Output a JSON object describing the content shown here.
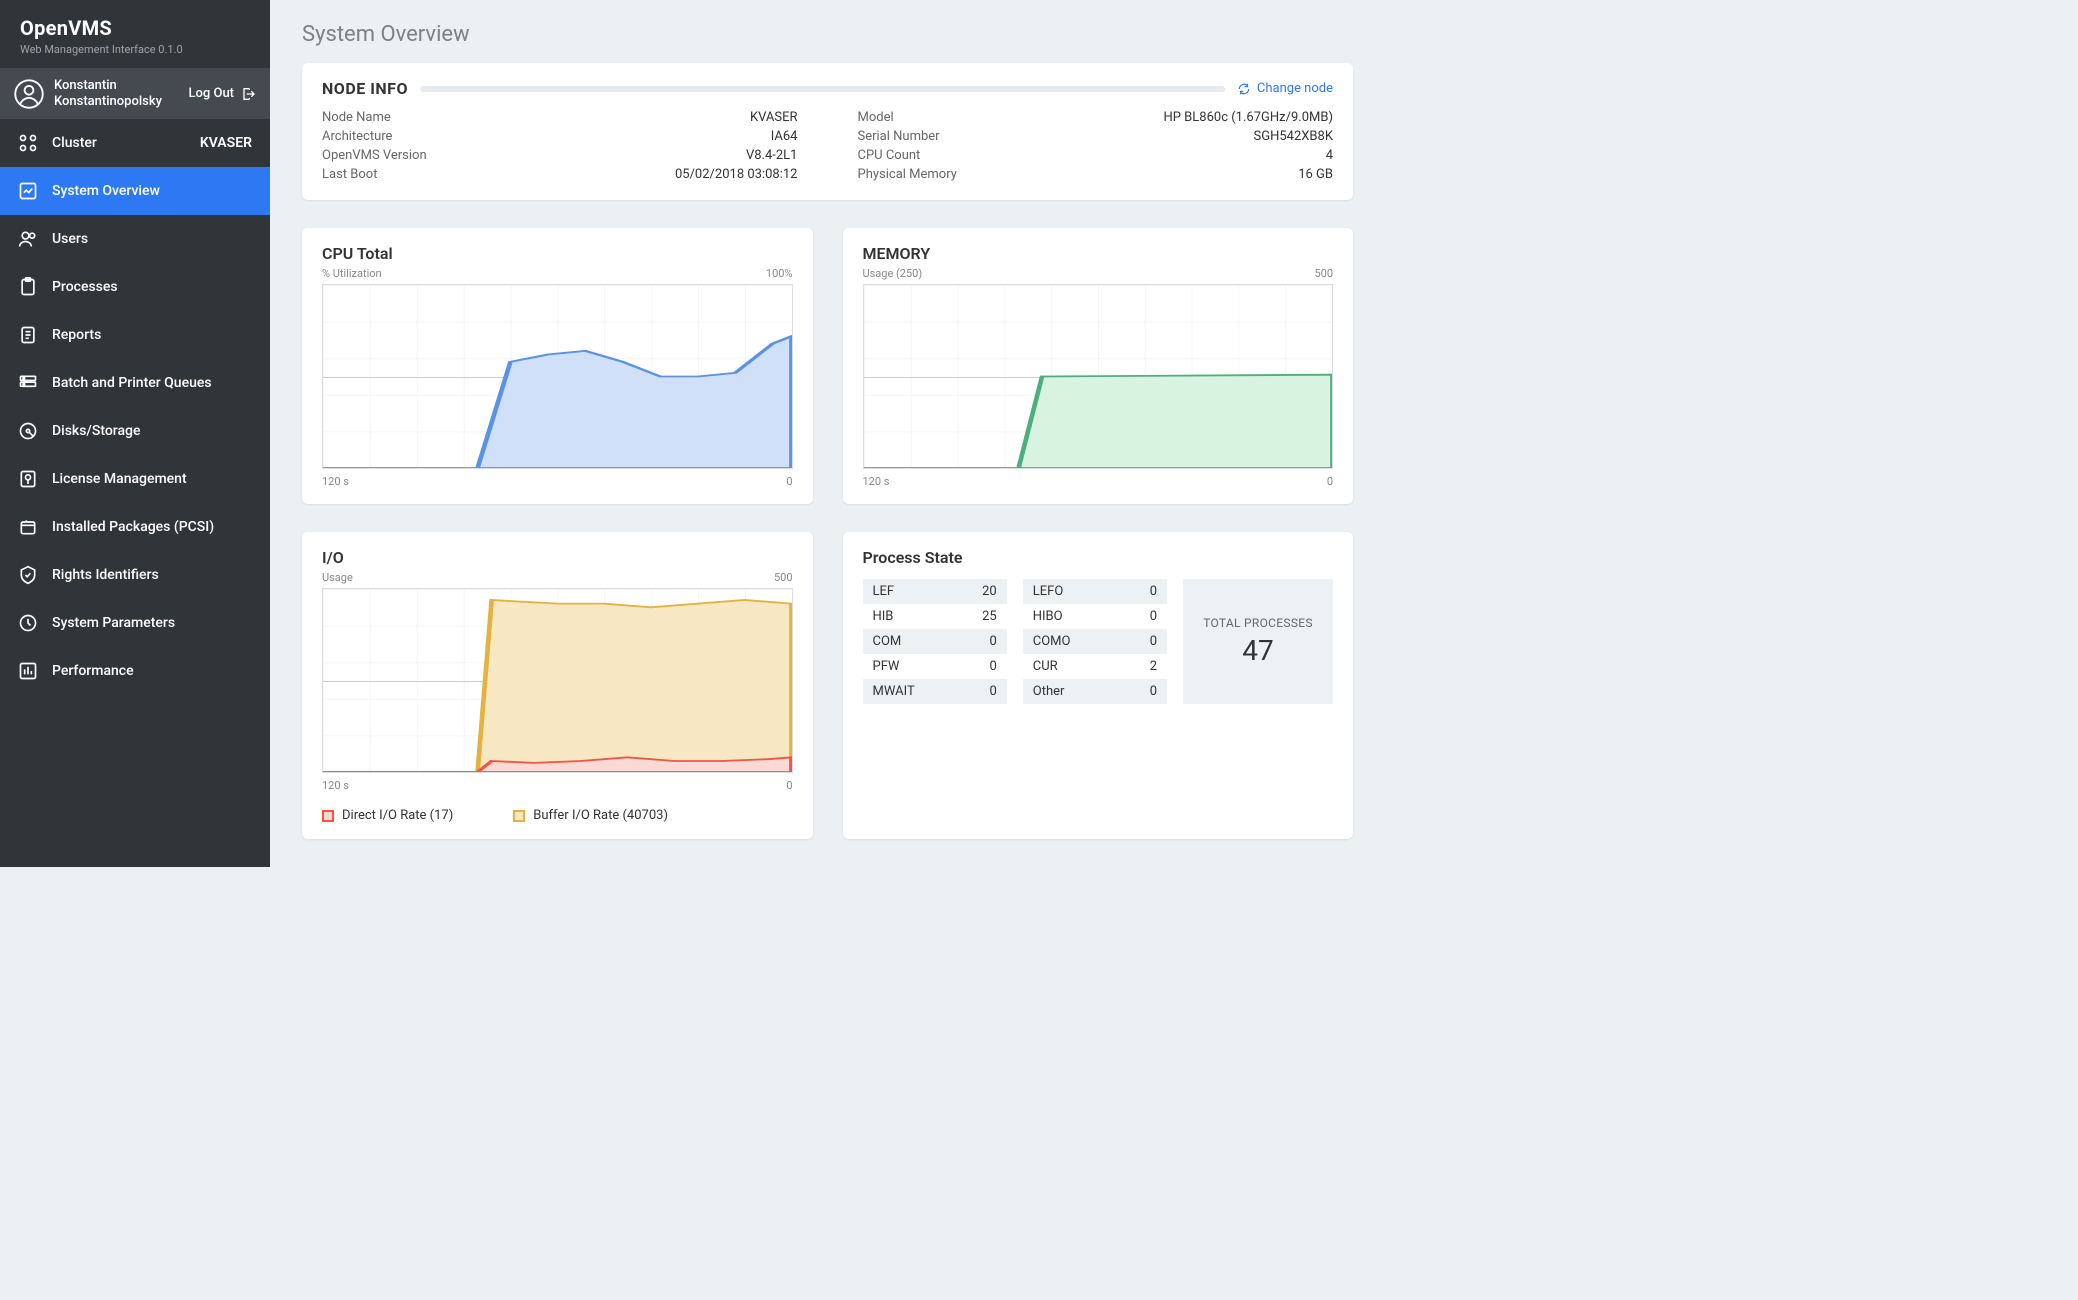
{
  "brand": {
    "title": "OpenVMS",
    "subtitle": "Web Management Interface 0.1.0"
  },
  "user": {
    "name": "Konstantin Konstantinopolsky",
    "logout": "Log Out"
  },
  "cluster": {
    "label": "Cluster",
    "value": "KVASER"
  },
  "nav": [
    {
      "label": "System Overview",
      "active": true,
      "icon": "overview"
    },
    {
      "label": "Users",
      "icon": "users"
    },
    {
      "label": "Processes",
      "icon": "processes"
    },
    {
      "label": "Reports",
      "icon": "reports"
    },
    {
      "label": "Batch and Printer Queues",
      "icon": "queues"
    },
    {
      "label": "Disks/Storage",
      "icon": "disks"
    },
    {
      "label": "License Management",
      "icon": "license"
    },
    {
      "label": "Installed Packages (PCSI)",
      "icon": "packages"
    },
    {
      "label": "Rights Identifiers",
      "icon": "rights"
    },
    {
      "label": "System Parameters",
      "icon": "params"
    },
    {
      "label": "Performance",
      "icon": "performance"
    }
  ],
  "page_title": "System Overview",
  "node_info": {
    "title": "NODE INFO",
    "change": "Change node",
    "left": [
      {
        "k": "Node Name",
        "v": "KVASER"
      },
      {
        "k": "Architecture",
        "v": "IA64"
      },
      {
        "k": "OpenVMS Version",
        "v": "V8.4-2L1"
      },
      {
        "k": "Last Boot",
        "v": "05/02/2018 03:08:12"
      }
    ],
    "right": [
      {
        "k": "Model",
        "v": "HP BL860c  (1.67GHz/9.0MB)"
      },
      {
        "k": "Serial Number",
        "v": "SGH542XB8K"
      },
      {
        "k": "CPU Count",
        "v": "4"
      },
      {
        "k": "Physical Memory",
        "v": "16 GB"
      }
    ]
  },
  "cpu": {
    "title": "CPU Total",
    "ylabel": "% Utilization",
    "ymax": "100%",
    "x0": "120 s",
    "x1": "0"
  },
  "mem": {
    "title": "MEMORY",
    "ylabel": "Usage (250)",
    "ymax": "500",
    "x0": "120 s",
    "x1": "0"
  },
  "io": {
    "title": "I/O",
    "ylabel": "Usage",
    "ymax": "500",
    "x0": "120 s",
    "x1": "0",
    "legend": [
      {
        "label": "Direct I/O Rate (17)"
      },
      {
        "label": "Buffer I/O Rate (40703)"
      }
    ]
  },
  "ps": {
    "title": "Process State",
    "col1": [
      {
        "k": "LEF",
        "v": "20"
      },
      {
        "k": "HIB",
        "v": "25"
      },
      {
        "k": "COM",
        "v": "0"
      },
      {
        "k": "PFW",
        "v": "0"
      },
      {
        "k": "MWAIT",
        "v": "0"
      }
    ],
    "col2": [
      {
        "k": "LEFO",
        "v": "0"
      },
      {
        "k": "HIBO",
        "v": "0"
      },
      {
        "k": "COMO",
        "v": "0"
      },
      {
        "k": "CUR",
        "v": "2"
      },
      {
        "k": "Other",
        "v": "0"
      }
    ],
    "total_label": "TOTAL PROCESSES",
    "total": "47"
  },
  "chart_data": [
    {
      "type": "area",
      "title": "CPU Total",
      "ylabel": "% Utilization",
      "ylim": [
        0,
        100
      ],
      "xlim": [
        120,
        0
      ],
      "series": [
        {
          "name": "cpu",
          "color": "#5b92e5",
          "values": [
            0,
            0,
            0,
            0,
            50,
            60,
            62,
            58,
            48,
            50,
            48,
            52,
            70
          ]
        }
      ]
    },
    {
      "type": "area",
      "title": "MEMORY",
      "ylabel": "Usage (250)",
      "ylim": [
        0,
        500
      ],
      "xlim": [
        120,
        0
      ],
      "series": [
        {
          "name": "mem",
          "color": "#4caf7d",
          "values": [
            0,
            0,
            0,
            0,
            250,
            255,
            252,
            255,
            252,
            255,
            252,
            255,
            254
          ]
        }
      ]
    },
    {
      "type": "area",
      "title": "I/O",
      "ylabel": "Usage",
      "ylim": [
        0,
        500
      ],
      "xlim": [
        120,
        0
      ],
      "series": [
        {
          "name": "Buffer I/O Rate",
          "color": "#e3b341",
          "values": [
            0,
            0,
            0,
            0,
            480,
            470,
            475,
            470,
            465,
            470,
            455,
            475,
            470
          ]
        },
        {
          "name": "Direct I/O Rate",
          "color": "#f05545",
          "values": [
            0,
            0,
            0,
            0,
            30,
            25,
            25,
            30,
            40,
            30,
            25,
            28,
            40
          ]
        }
      ]
    }
  ]
}
